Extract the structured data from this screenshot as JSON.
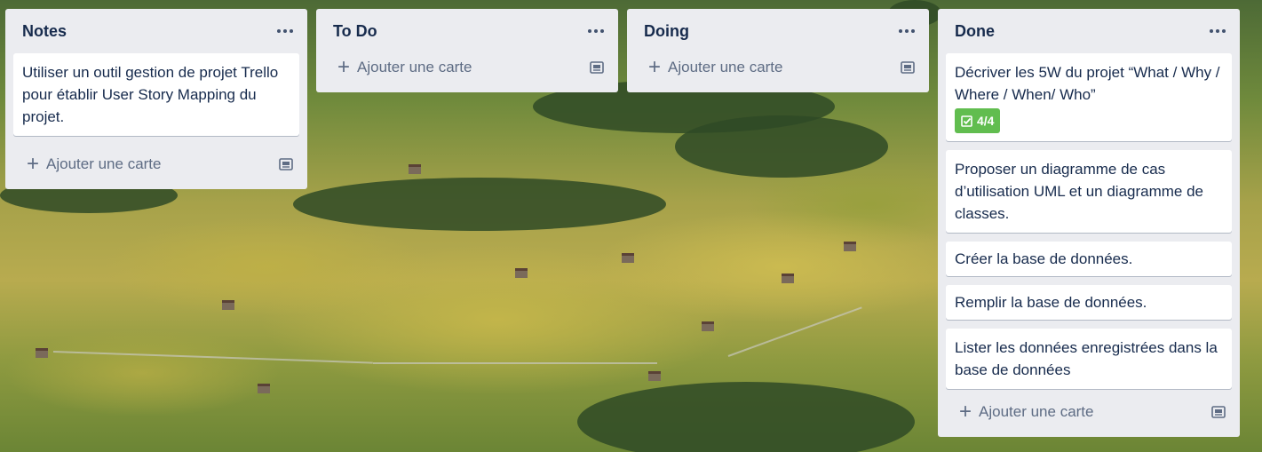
{
  "board": {
    "lists": [
      {
        "title": "Notes",
        "cards": [
          {
            "text": "Utiliser un outil gestion de projet Trello pour établir User Story Mapping du projet."
          }
        ],
        "add_card_label": "Ajouter une carte"
      },
      {
        "title": "To Do",
        "cards": [],
        "add_card_label": "Ajouter une carte"
      },
      {
        "title": "Doing",
        "cards": [],
        "add_card_label": "Ajouter une carte"
      },
      {
        "title": "Done",
        "cards": [
          {
            "text": "Décriver les 5W du projet “What / Why / Where / When/ Who”",
            "checklist": "4/4"
          },
          {
            "text": "Proposer un diagramme de cas d’utilisation UML et un diagramme de classes."
          },
          {
            "text": "Créer la base de données."
          },
          {
            "text": "Remplir la base de données."
          },
          {
            "text": "Lister les données enregistrées dans la base de données"
          }
        ],
        "add_card_label": "Ajouter une carte"
      }
    ]
  },
  "colors": {
    "list_bg": "#ebecf0",
    "card_bg": "#ffffff",
    "checklist_complete": "#61bd4f",
    "text": "#172b4d",
    "muted_text": "#5e6c84"
  },
  "icons": {
    "list_menu": "more-horizontal-icon",
    "add": "plus-icon",
    "template": "card-template-icon",
    "checklist": "checklist-icon"
  }
}
